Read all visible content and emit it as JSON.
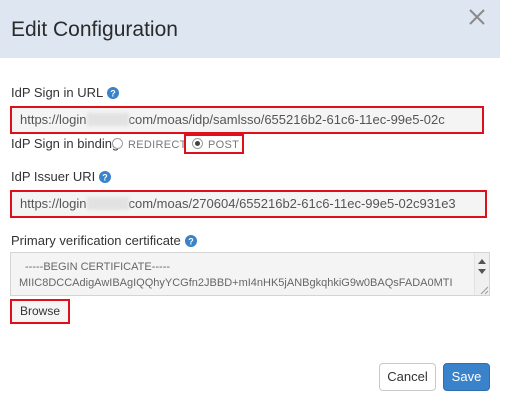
{
  "dialog": {
    "title": "Edit Configuration"
  },
  "icons": {
    "close": "close-icon",
    "help": "question-circle-icon"
  },
  "colors": {
    "accent": "#3a82c9",
    "header_bg": "#dde6f1",
    "highlight": "#e0101a"
  },
  "fields": {
    "sign_in_url": {
      "label": "IdP Sign in URL",
      "value_prefix": "https://login",
      "value_suffix": "com/moas/idp/samlsso/655216b2-61c6-11ec-99e5-02c"
    },
    "binding": {
      "label": "IdP Sign in binding",
      "options": [
        "REDIRECT",
        "POST"
      ],
      "selected": "POST"
    },
    "issuer_uri": {
      "label": "IdP Issuer URI",
      "value_prefix": "https://login",
      "value_suffix": "com/moas/270604/655216b2-61c6-11ec-99e5-02c931e3"
    },
    "certificate": {
      "label": "Primary verification certificate",
      "line1": "-----BEGIN CERTIFICATE-----",
      "line2": "MIIC8DCCAdigAwIBAgIQQhyYCGfn2JBBD+mI4nHK5jANBgkqhkiG9w0BAQsFADA0MTI"
    }
  },
  "buttons": {
    "browse": "Browse",
    "cancel": "Cancel",
    "save": "Save"
  }
}
